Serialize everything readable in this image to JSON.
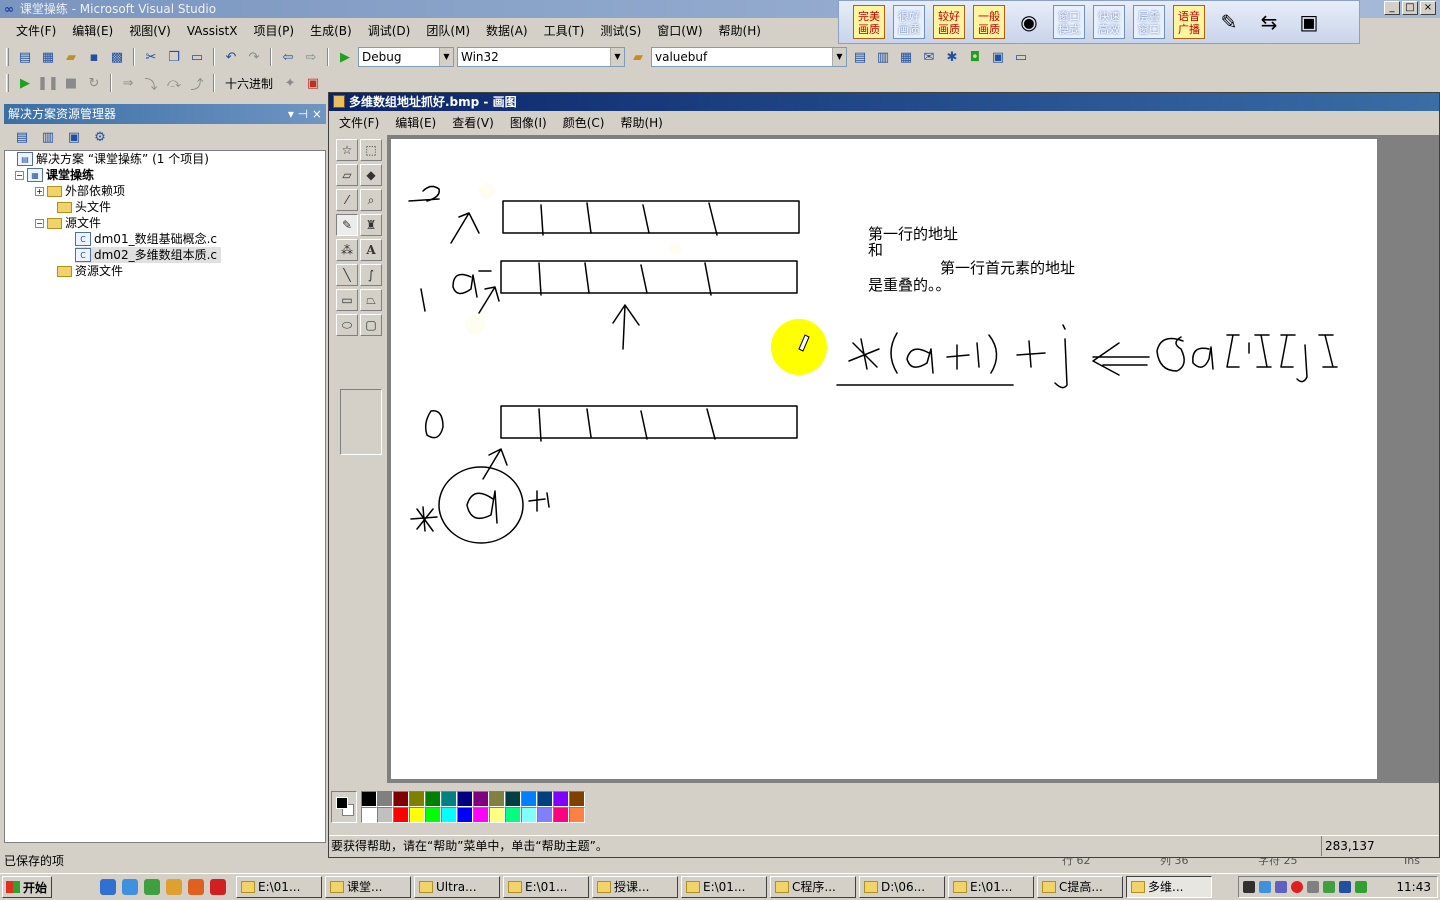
{
  "window": {
    "title": "课堂操练 - Microsoft Visual Studio",
    "controls": [
      "_",
      "□",
      "×"
    ]
  },
  "plugin_bar": {
    "buttons": [
      {
        "label": "完美画质",
        "style": "orange"
      },
      {
        "label": "很好画质",
        "style": "blue"
      },
      {
        "label": "较好画质",
        "style": "orange"
      },
      {
        "label": "一般画质",
        "style": "orange"
      },
      {
        "label": "窗口模式",
        "style": "blue"
      },
      {
        "label": "快速高效",
        "style": "blue"
      },
      {
        "label": "层叠窗口",
        "style": "blue"
      },
      {
        "label": "语音广播",
        "style": "orange"
      }
    ]
  },
  "menubar": {
    "items": [
      "文件(F)",
      "编辑(E)",
      "视图(V)",
      "VAssistX",
      "项目(P)",
      "生成(B)",
      "调试(D)",
      "团队(M)",
      "数据(A)",
      "工具(T)",
      "测试(S)",
      "窗口(W)",
      "帮助(H)"
    ]
  },
  "toolbar": {
    "config": "Debug",
    "platform": "Win32",
    "find": "valuebuf",
    "hex_label": "十六进制"
  },
  "solution_explorer": {
    "title": "解决方案资源管理器",
    "pin": "▾ ⊣ ×",
    "tree": [
      {
        "label": "解决方案 “课堂操练” (1 个项目)",
        "depth": 0,
        "icon": "solution"
      },
      {
        "label": "课堂操练",
        "depth": 1,
        "icon": "project",
        "bold": true
      },
      {
        "label": "外部依赖项",
        "depth": 2,
        "icon": "folder"
      },
      {
        "label": "头文件",
        "depth": 2,
        "icon": "folder"
      },
      {
        "label": "源文件",
        "depth": 2,
        "icon": "folder"
      },
      {
        "label": "dm01_数组基础概念.c",
        "depth": 3,
        "icon": "c-file"
      },
      {
        "label": "dm02_多维数组本质.c",
        "depth": 3,
        "icon": "c-file",
        "selected": true
      },
      {
        "label": "资源文件",
        "depth": 2,
        "icon": "folder"
      }
    ]
  },
  "vs_status": {
    "message": "已保存的项",
    "line": "行 62",
    "col": "列 36",
    "char": "字符 25",
    "mode": "Ins"
  },
  "paint": {
    "title": "多维数组地址抓好.bmp - 画图",
    "menu": [
      "文件(F)",
      "编辑(E)",
      "查看(V)",
      "图像(I)",
      "颜色(C)",
      "帮助(H)"
    ],
    "status": "要获得帮助，请在“帮助”菜单中，单击“帮助主题”。",
    "coords": "283,137",
    "canvas_text": {
      "line1": "第一行的地址",
      "line2": "和",
      "line3": "第一行首元素的地址",
      "line4": "是重叠的。。",
      "hand_label_2": "2",
      "hand_label_1": "1",
      "hand_label_0": "0",
      "hand_a": "a",
      "hand_star": "*",
      "hand_plus1": "+1",
      "formula": "*(a+1)+j <=> &a[i][j]"
    },
    "palette": [
      "#000000",
      "#808080",
      "#800000",
      "#808000",
      "#008000",
      "#008080",
      "#000080",
      "#800080",
      "#808040",
      "#004040",
      "#0080ff",
      "#004080",
      "#8000ff",
      "#804000",
      "#ffffff",
      "#c0c0c0",
      "#ff0000",
      "#ffff00",
      "#00ff00",
      "#00ffff",
      "#0000ff",
      "#ff00ff",
      "#ffff80",
      "#00ff80",
      "#80ffff",
      "#8080ff",
      "#ff0080",
      "#ff8040"
    ]
  },
  "taskbar": {
    "start": "开始",
    "tasks": [
      "E:\\01...",
      "课堂...",
      "Ultra...",
      "E:\\01...",
      "授课...",
      "E:\\01...",
      "C程序...",
      "D:\\06...",
      "E:\\01...",
      "C提高...",
      "多维..."
    ],
    "clock": "11:43"
  }
}
